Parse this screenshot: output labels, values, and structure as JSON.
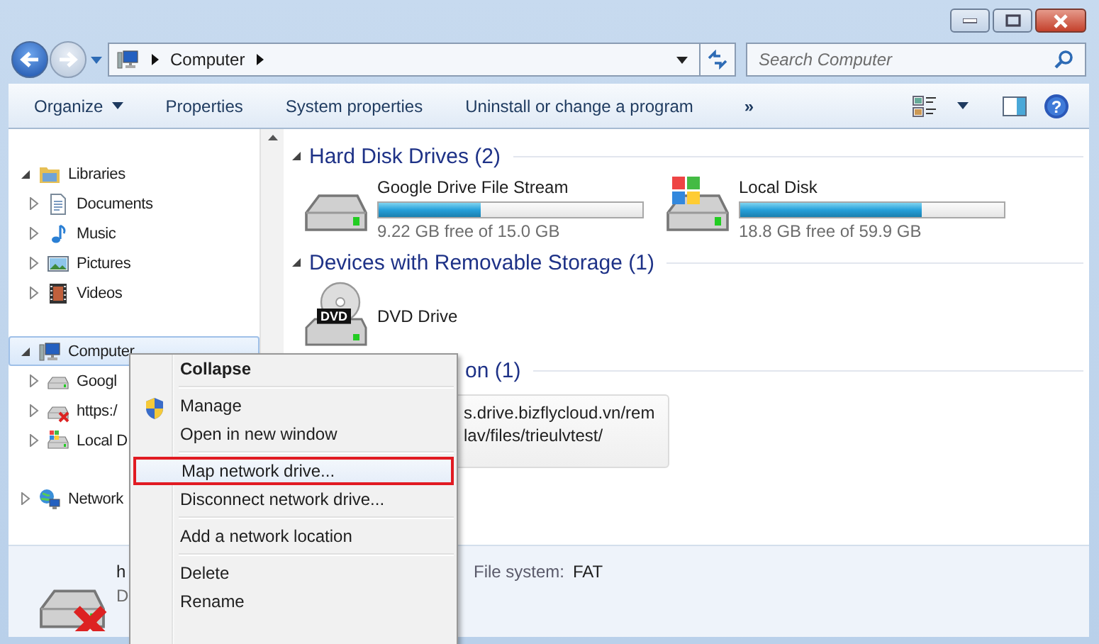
{
  "address_bar": {
    "path": "Computer"
  },
  "search": {
    "placeholder": "Search Computer"
  },
  "toolbar": {
    "items": [
      {
        "label": "Organize",
        "kind": "menu"
      },
      {
        "label": "Properties",
        "kind": "button"
      },
      {
        "label": "System properties",
        "kind": "button"
      },
      {
        "label": "Uninstall or change a program",
        "kind": "button"
      },
      {
        "label": "»",
        "kind": "overflow"
      }
    ],
    "help": "?"
  },
  "sidebar": {
    "items": [
      {
        "label": "Libraries",
        "kind": "library",
        "expanded": true,
        "selected": false,
        "children": [
          {
            "label": "Documents",
            "kind": "document",
            "expanded": false,
            "selected": false
          },
          {
            "label": "Music",
            "kind": "music",
            "expanded": false,
            "selected": false
          },
          {
            "label": "Pictures",
            "kind": "pictures",
            "expanded": false,
            "selected": false
          },
          {
            "label": "Videos",
            "kind": "video",
            "expanded": false,
            "selected": false
          }
        ]
      },
      {
        "label": "Computer",
        "kind": "computer",
        "expanded": true,
        "selected": true,
        "children": [
          {
            "label": "Googl",
            "kind": "drive",
            "expanded": false,
            "selected": false
          },
          {
            "label": "https:/",
            "kind": "netdrive",
            "expanded": false,
            "selected": false
          },
          {
            "label": "Local D",
            "kind": "sysdrive",
            "expanded": false,
            "selected": false
          }
        ]
      },
      {
        "label": "Network",
        "kind": "network",
        "expanded": false,
        "selected": false
      }
    ]
  },
  "sections": [
    {
      "title": "Hard Disk Drives (2)",
      "kind": "full",
      "expanded": true,
      "items": [
        {
          "name": "Google Drive File Stream",
          "kind": "drive",
          "level": 0.385,
          "free": "9.22 GB free of 15.0 GB"
        },
        {
          "name": "Local Disk",
          "kind": "sysdrive",
          "level": 0.686,
          "free": "18.8 GB free of 59.9 GB"
        }
      ]
    },
    {
      "title": "Devices with Removable Storage (1)",
      "kind": "full",
      "expanded": true,
      "items": [
        {
          "name": "DVD Drive",
          "kind": "dvd",
          "badge": "DVD"
        }
      ]
    },
    {
      "title": "on (1)",
      "kind": "partial",
      "items": [
        {
          "kind": "location",
          "lines": [
            "s.drive.bizflycloud.vn/rem",
            "lav/files/trieulvtest/"
          ]
        }
      ]
    }
  ],
  "details": {
    "name": "h",
    "subtitle": "D",
    "fields": [
      {
        "label": "File system:",
        "value": "FAT"
      }
    ]
  },
  "context_menu": {
    "items": [
      {
        "label": "Collapse",
        "kind": "default",
        "selected": false
      },
      {
        "kind": "separator"
      },
      {
        "label": "Manage",
        "kind": "shield",
        "selected": false
      },
      {
        "label": "Open in new window",
        "kind": "item",
        "selected": false
      },
      {
        "kind": "separator"
      },
      {
        "label": "Map network drive...",
        "kind": "item",
        "selected": true
      },
      {
        "label": "Disconnect network drive...",
        "kind": "item",
        "selected": false
      },
      {
        "kind": "separator"
      },
      {
        "label": "Add a network location",
        "kind": "item",
        "selected": false
      },
      {
        "kind": "separator"
      },
      {
        "label": "Delete",
        "kind": "item",
        "selected": false
      },
      {
        "label": "Rename",
        "kind": "item",
        "selected": false
      }
    ]
  }
}
